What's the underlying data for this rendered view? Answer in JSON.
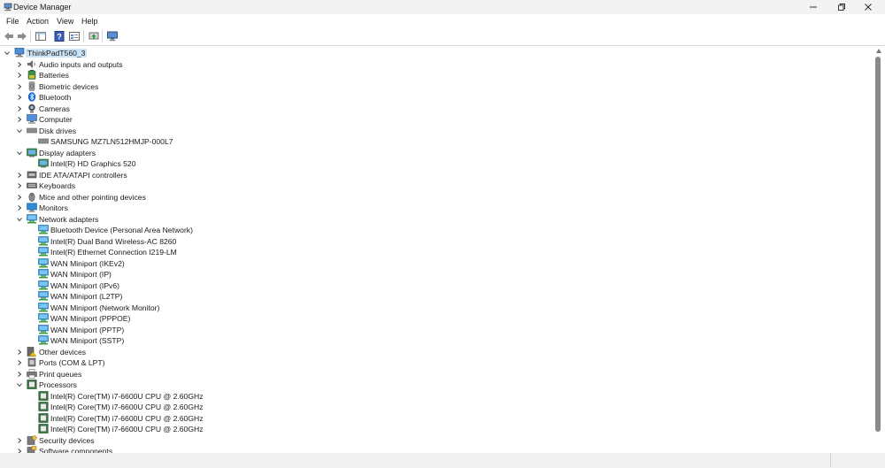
{
  "window": {
    "title": "Device Manager"
  },
  "menu": {
    "file": "File",
    "action": "Action",
    "view": "View",
    "help": "Help"
  },
  "toolbar": {
    "icons": [
      "back-arrow-icon",
      "forward-arrow-icon",
      "properties-pane-icon",
      "help-icon",
      "console-tree-icon",
      "update-driver-icon",
      "scan-hardware-icon"
    ]
  },
  "tree": {
    "root": "ThinkPadT560_3",
    "nodes": [
      {
        "label": "Audio inputs and outputs",
        "level": 1,
        "state": "collapsed",
        "icon": "speaker-icon"
      },
      {
        "label": "Batteries",
        "level": 1,
        "state": "collapsed",
        "icon": "battery-icon"
      },
      {
        "label": "Biometric devices",
        "level": 1,
        "state": "collapsed",
        "icon": "fingerprint-icon"
      },
      {
        "label": "Bluetooth",
        "level": 1,
        "state": "collapsed",
        "icon": "bluetooth-icon"
      },
      {
        "label": "Cameras",
        "level": 1,
        "state": "collapsed",
        "icon": "camera-icon"
      },
      {
        "label": "Computer",
        "level": 1,
        "state": "collapsed",
        "icon": "computer-icon"
      },
      {
        "label": "Disk drives",
        "level": 1,
        "state": "expanded",
        "icon": "disk-icon"
      },
      {
        "label": "SAMSUNG MZ7LN512HMJP-000L7",
        "level": 2,
        "state": "leaf",
        "icon": "disk-icon"
      },
      {
        "label": "Display adapters",
        "level": 1,
        "state": "expanded",
        "icon": "display-icon"
      },
      {
        "label": "Intel(R) HD Graphics 520",
        "level": 2,
        "state": "leaf",
        "icon": "display-icon"
      },
      {
        "label": "IDE ATA/ATAPI controllers",
        "level": 1,
        "state": "collapsed",
        "icon": "ide-icon"
      },
      {
        "label": "Keyboards",
        "level": 1,
        "state": "collapsed",
        "icon": "keyboard-icon"
      },
      {
        "label": "Mice and other pointing devices",
        "level": 1,
        "state": "collapsed",
        "icon": "mouse-icon"
      },
      {
        "label": "Monitors",
        "level": 1,
        "state": "collapsed",
        "icon": "monitor-icon"
      },
      {
        "label": "Network adapters",
        "level": 1,
        "state": "expanded",
        "icon": "network-icon"
      },
      {
        "label": "Bluetooth Device (Personal Area Network)",
        "level": 2,
        "state": "leaf",
        "icon": "network-icon"
      },
      {
        "label": "Intel(R) Dual Band Wireless-AC 8260",
        "level": 2,
        "state": "leaf",
        "icon": "network-icon"
      },
      {
        "label": "Intel(R) Ethernet Connection I219-LM",
        "level": 2,
        "state": "leaf",
        "icon": "network-icon"
      },
      {
        "label": "WAN Miniport (IKEv2)",
        "level": 2,
        "state": "leaf",
        "icon": "network-icon"
      },
      {
        "label": "WAN Miniport (IP)",
        "level": 2,
        "state": "leaf",
        "icon": "network-icon"
      },
      {
        "label": "WAN Miniport (IPv6)",
        "level": 2,
        "state": "leaf",
        "icon": "network-icon"
      },
      {
        "label": "WAN Miniport (L2TP)",
        "level": 2,
        "state": "leaf",
        "icon": "network-icon"
      },
      {
        "label": "WAN Miniport (Network Monitor)",
        "level": 2,
        "state": "leaf",
        "icon": "network-icon"
      },
      {
        "label": "WAN Miniport (PPPOE)",
        "level": 2,
        "state": "leaf",
        "icon": "network-icon"
      },
      {
        "label": "WAN Miniport (PPTP)",
        "level": 2,
        "state": "leaf",
        "icon": "network-icon"
      },
      {
        "label": "WAN Miniport (SSTP)",
        "level": 2,
        "state": "leaf",
        "icon": "network-icon"
      },
      {
        "label": "Other devices",
        "level": 1,
        "state": "collapsed",
        "icon": "other-devices-icon"
      },
      {
        "label": "Ports (COM & LPT)",
        "level": 1,
        "state": "collapsed",
        "icon": "port-icon"
      },
      {
        "label": "Print queues",
        "level": 1,
        "state": "collapsed",
        "icon": "printer-icon"
      },
      {
        "label": "Processors",
        "level": 1,
        "state": "expanded",
        "icon": "processor-icon"
      },
      {
        "label": "Intel(R) Core(TM) i7-6600U CPU @ 2.60GHz",
        "level": 2,
        "state": "leaf",
        "icon": "processor-icon"
      },
      {
        "label": "Intel(R) Core(TM) i7-6600U CPU @ 2.60GHz",
        "level": 2,
        "state": "leaf",
        "icon": "processor-icon"
      },
      {
        "label": "Intel(R) Core(TM) i7-6600U CPU @ 2.60GHz",
        "level": 2,
        "state": "leaf",
        "icon": "processor-icon"
      },
      {
        "label": "Intel(R) Core(TM) i7-6600U CPU @ 2.60GHz",
        "level": 2,
        "state": "leaf",
        "icon": "processor-icon"
      },
      {
        "label": "Security devices",
        "level": 1,
        "state": "collapsed",
        "icon": "security-icon"
      },
      {
        "label": "Software components",
        "level": 1,
        "state": "collapsed",
        "icon": "software-icon"
      }
    ]
  }
}
